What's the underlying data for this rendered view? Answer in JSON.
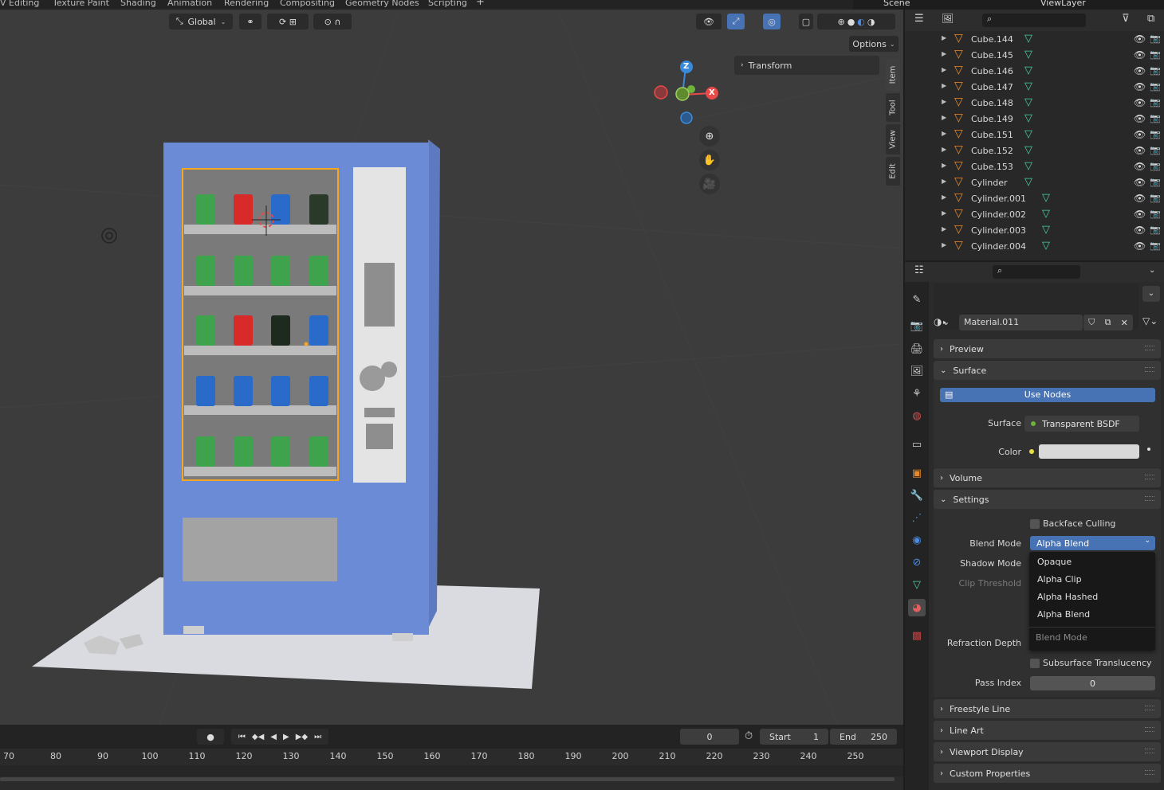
{
  "workspace_tabs": [
    "V Editing",
    "Texture Paint",
    "Shading",
    "Animation",
    "Rendering",
    "Compositing",
    "Geometry Nodes",
    "Scripting",
    "+"
  ],
  "top_right": {
    "scene_label": "Scene",
    "view_layer_label": "ViewLayer"
  },
  "viewport": {
    "orientation": "Global",
    "options_label": "Options",
    "transform_label": "Transform",
    "side_tabs": [
      "Item",
      "Tool",
      "View",
      "Edit"
    ],
    "gizmo_axes": {
      "z": "Z",
      "x": "X"
    }
  },
  "outliner": {
    "items": [
      {
        "name": "Cube.144"
      },
      {
        "name": "Cube.145"
      },
      {
        "name": "Cube.146"
      },
      {
        "name": "Cube.147"
      },
      {
        "name": "Cube.148"
      },
      {
        "name": "Cube.149"
      },
      {
        "name": "Cube.151"
      },
      {
        "name": "Cube.152"
      },
      {
        "name": "Cube.153"
      },
      {
        "name": "Cylinder"
      },
      {
        "name": "Cylinder.001"
      },
      {
        "name": "Cylinder.002"
      },
      {
        "name": "Cylinder.003"
      },
      {
        "name": "Cylinder.004"
      }
    ]
  },
  "properties": {
    "material_name": "Material.011",
    "panels": {
      "preview": "Preview",
      "surface": "Surface",
      "volume": "Volume",
      "settings": "Settings",
      "freestyle": "Freestyle Line",
      "lineart": "Line Art",
      "viewport_display": "Viewport Display",
      "custom_props": "Custom Properties"
    },
    "use_nodes": "Use Nodes",
    "surface_label": "Surface",
    "surface_value": "Transparent BSDF",
    "color_label": "Color",
    "color_value": "#d9d9d9",
    "backface_culling": "Backface Culling",
    "blend_mode_label": "Blend Mode",
    "blend_mode_value": "Alpha Blend",
    "shadow_mode_label": "Shadow Mode",
    "clip_threshold_label": "Clip Threshold",
    "refraction_depth_label": "Refraction Depth",
    "subsurface_translucency": "Subsurface Translucency",
    "pass_index_label": "Pass Index",
    "pass_index_value": "0",
    "dropdown": {
      "options": [
        "Opaque",
        "Alpha Clip",
        "Alpha Hashed",
        "Alpha Blend"
      ],
      "title": "Blend Mode"
    }
  },
  "timeline": {
    "current_frame": "0",
    "start_label": "Start",
    "start_value": "1",
    "end_label": "End",
    "end_value": "250",
    "ruler": [
      "70",
      "80",
      "90",
      "100",
      "110",
      "120",
      "130",
      "140",
      "150",
      "160",
      "170",
      "180",
      "190",
      "200",
      "210",
      "220",
      "230",
      "240",
      "250"
    ]
  },
  "colors": {
    "accent": "#4772b3",
    "machine_blue": "#6b8bd6",
    "selection_orange": "#f5a623",
    "mesh_icon_orange": "#e8892c",
    "mesh_data_green": "#4dd0a0"
  }
}
